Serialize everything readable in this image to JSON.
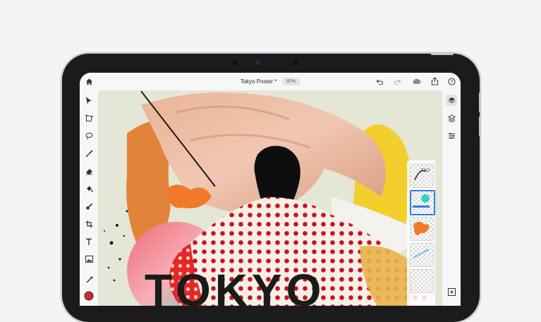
{
  "document": {
    "title": "Tokyo Poster *",
    "zoom": "97%"
  },
  "canvas_text": "TOKYO",
  "top_icons": [
    "home-icon",
    "undo-icon",
    "redo-icon",
    "cloud-icon",
    "share-icon",
    "help-icon"
  ],
  "tools": [
    "select-icon",
    "transform-icon",
    "lasso-icon",
    "brush-icon",
    "eraser-icon",
    "fill-icon",
    "smudge-icon",
    "crop-icon",
    "text-icon",
    "image-icon",
    "eyedropper-icon",
    "color-swatch-icon"
  ],
  "right_icons": [
    "layers-icon",
    "layer-properties-icon",
    "adjustments-icon",
    "add-layer-icon"
  ],
  "colors": {
    "accent": "#2b7de9",
    "current_color": "#d7262c",
    "canvas_bg": "#e4e6d6"
  }
}
